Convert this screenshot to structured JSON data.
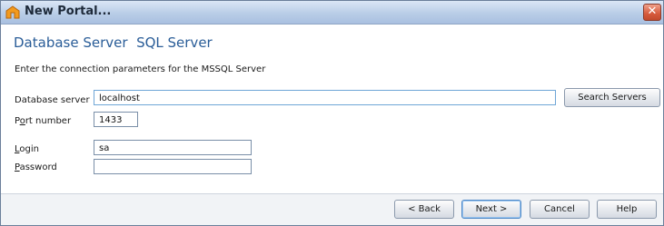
{
  "window": {
    "title": "New Portal...",
    "close_glyph": "✕"
  },
  "header": {
    "section_title": "Database Server  SQL Server",
    "description": "Enter the connection parameters for the MSSQL Server"
  },
  "form": {
    "database_server": {
      "label": "Database server",
      "value": "localhost"
    },
    "search_servers_label": "Search Servers",
    "port": {
      "label_pre": "P",
      "label_u": "o",
      "label_post": "rt number",
      "value": "1433"
    },
    "login": {
      "label_pre": "",
      "label_u": "L",
      "label_post": "ogin",
      "value": "sa"
    },
    "password": {
      "label_pre": "",
      "label_u": "P",
      "label_post": "assword",
      "value": ""
    }
  },
  "footer": {
    "back_label": "< Back",
    "next_label": "Next >",
    "cancel_label": "Cancel",
    "help_label": "Help"
  },
  "colors": {
    "title_accent": "#2a5d98",
    "close_button": "#d65a3c"
  },
  "icons": {
    "app": "portal-app-icon",
    "close": "close-icon"
  }
}
